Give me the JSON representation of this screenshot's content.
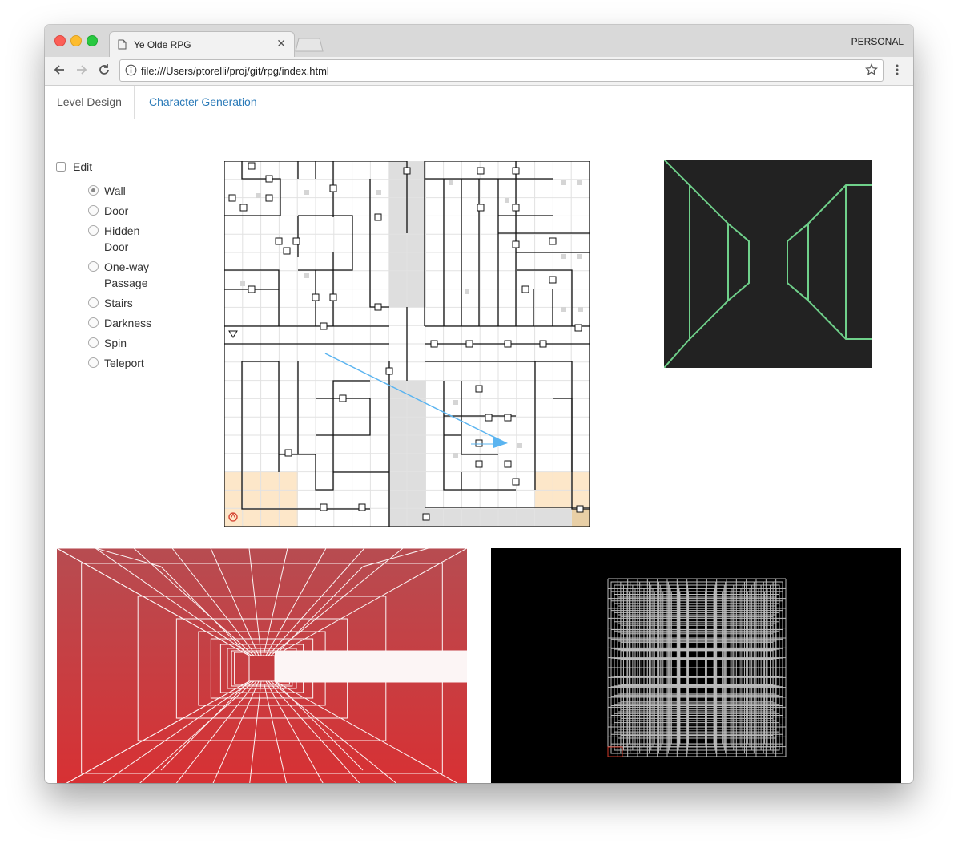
{
  "browser": {
    "tab_title": "Ye Olde RPG",
    "profile": "PERSONAL",
    "url": "file:///Users/ptorelli/proj/git/rpg/index.html"
  },
  "app_tabs": {
    "level_design": "Level Design",
    "character_generation": "Character Generation"
  },
  "editor": {
    "edit_label": "Edit",
    "edit_checked": false,
    "tools": [
      {
        "label": "Wall",
        "selected": true
      },
      {
        "label": "Door",
        "selected": false
      },
      {
        "label": "Hidden Door",
        "selected": false
      },
      {
        "label": "One-way Passage",
        "selected": false
      },
      {
        "label": "Stairs",
        "selected": false
      },
      {
        "label": "Darkness",
        "selected": false
      },
      {
        "label": "Spin",
        "selected": false
      },
      {
        "label": "Teleport",
        "selected": false
      }
    ]
  },
  "colors": {
    "wireframe_green": "#6fd08a",
    "corridor_red": "#d2323a",
    "selection_orange": "#fde7c9",
    "link_blue": "#2a7ab8",
    "arrow_blue": "#5ab4f0"
  }
}
